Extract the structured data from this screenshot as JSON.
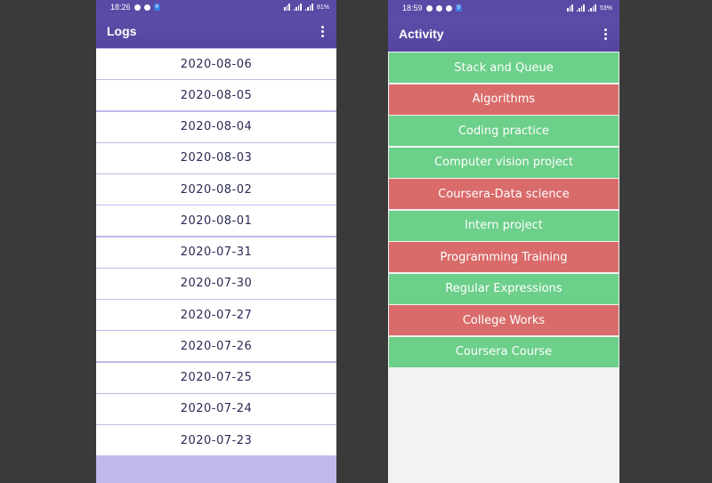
{
  "left_phone": {
    "status": {
      "time": "18:26",
      "battery_text": "81%"
    },
    "title": "Logs",
    "rows": [
      "2020-08-06",
      "2020-08-05",
      "2020-08-04",
      "2020-08-03",
      "2020-08-02",
      "2020-08-01",
      "2020-07-31",
      "2020-07-30",
      "2020-07-27",
      "2020-07-26",
      "2020-07-25",
      "2020-07-24",
      "2020-07-23"
    ]
  },
  "right_phone": {
    "status": {
      "time": "18:59",
      "battery_text": "53%"
    },
    "title": "Activity",
    "items": [
      {
        "label": "Stack and Queue",
        "status": "green"
      },
      {
        "label": "Algorithms",
        "status": "red"
      },
      {
        "label": "Coding practice",
        "status": "green"
      },
      {
        "label": "Computer vision project",
        "status": "green"
      },
      {
        "label": "Coursera-Data science",
        "status": "red"
      },
      {
        "label": "Intern project",
        "status": "green"
      },
      {
        "label": "Programming Training",
        "status": "red"
      },
      {
        "label": "Regular Expressions",
        "status": "green"
      },
      {
        "label": "College Works",
        "status": "red"
      },
      {
        "label": "Coursera Course",
        "status": "green"
      }
    ]
  },
  "colors": {
    "appbar": "#5a4aa6",
    "green": "#6ccf8a",
    "red": "#d96b6b",
    "logs_bg": "#c2b8eb"
  }
}
